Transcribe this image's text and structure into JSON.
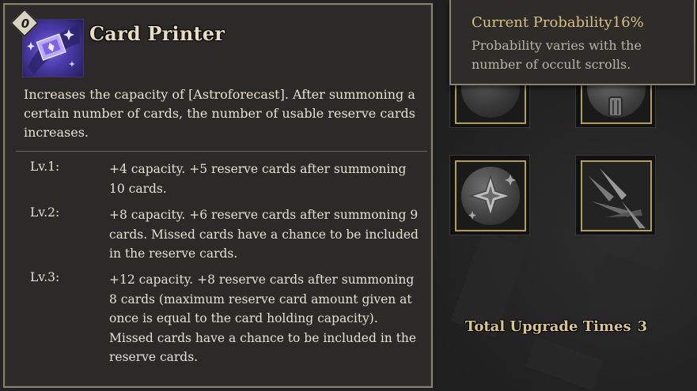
{
  "card": {
    "badge": "0",
    "icon": "astro-card-icon",
    "title": "Card Printer",
    "description": "Increases the capacity of [Astroforecast]. After summoning a certain number of cards, the number of usable reserve cards increases.",
    "levels": [
      {
        "label": "Lv.1:",
        "text": "+4 capacity. +5 reserve cards after summoning 10 cards."
      },
      {
        "label": "Lv.2:",
        "text": "+8 capacity. +6 reserve cards after summoning 9 cards. Missed cards have a chance to be included in the reserve cards."
      },
      {
        "label": "Lv.3:",
        "text": "+12 capacity. +8 reserve cards after summoning 8 cards (maximum reserve card amount given at once is equal to the card holding capacity). Missed cards have a chance to be included in the reserve cards."
      }
    ]
  },
  "tooltip": {
    "title": "Current Probability16%",
    "body": "Probability varies with the number of occult scrolls."
  },
  "slots": [
    {
      "icon": "orb-icon"
    },
    {
      "icon": "scroll-icon"
    },
    {
      "icon": "star-sparkle-icon"
    },
    {
      "icon": "blades-icon"
    }
  ],
  "upgrade": {
    "label": "Total Upgrade Times",
    "value": "3"
  },
  "colors": {
    "accent_gold": "#b49d57",
    "title_text": "#e9dcc0",
    "tooltip_title": "#d9bf86",
    "icon_purple": "#6a54d0"
  }
}
